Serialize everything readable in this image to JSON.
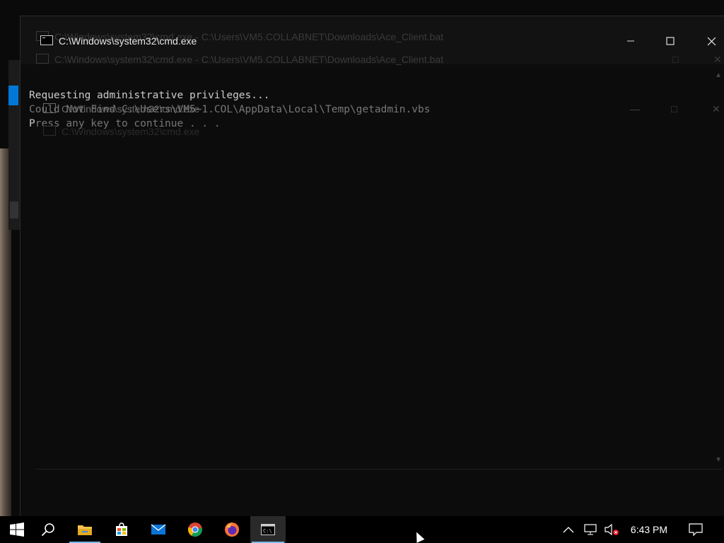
{
  "windows": {
    "main": {
      "title": "C:\\Windows\\system32\\cmd.exe",
      "minimize_icon": "minimize-icon",
      "maximize_icon": "maximize-icon",
      "close_icon": "close-icon"
    },
    "ghost_1": {
      "title": "C:\\Windows\\system32\\cmd.exe - C:\\Users\\VM5.COLLABNET\\Downloads\\Ace_Client.bat"
    },
    "ghost_2": {
      "title": "C:\\Windows\\system32\\cmd.exe - C:\\Users\\VM5.COLLABNET\\Downloads\\Ace_Client.bat"
    },
    "ghost_3": {
      "title": "C:\\Windows\\system32\\cmd.exe"
    },
    "ghost_4": {
      "title": "C:\\Windows\\system32\\cmd.exe"
    }
  },
  "console": {
    "line1": "Requesting administrative privileges...",
    "line2": "Could Not Find C:\\Users\\VM5~1.COL\\AppData\\Local\\Temp\\getadmin.vbs",
    "line3_prefix": "P",
    "line3_rest": "ress any key to continue . . ."
  },
  "taskbar": {
    "apps": [
      "start-icon",
      "search-icon",
      "file-explorer-icon",
      "store-icon",
      "mail-icon",
      "chrome-icon",
      "firefox-icon",
      "cmd-icon"
    ],
    "tray": {
      "chevron": "chevron-up-icon",
      "network": "network-icon",
      "volume": "volume-muted-icon",
      "time": "6:43 PM",
      "notifications": "notification-icon"
    }
  },
  "colors": {
    "console_bg": "#0c0c0c",
    "console_fg": "#cccccc",
    "taskbar_bg": "#000000",
    "accent": "#0078d7"
  }
}
